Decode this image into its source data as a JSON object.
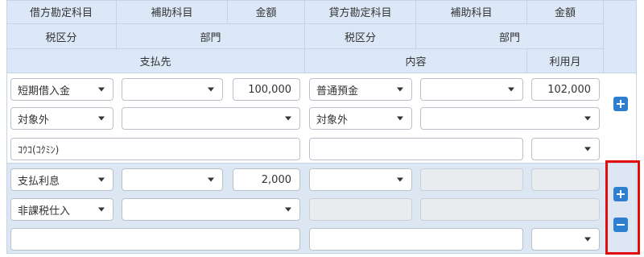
{
  "headers": {
    "row1": [
      "借方勘定科目",
      "補助科目",
      "金額",
      "貸方勘定科目",
      "補助科目",
      "金額"
    ],
    "row2": [
      "税区分",
      "部門",
      "税区分",
      "部門"
    ],
    "row3": [
      "支払先",
      "内容",
      "利用月"
    ]
  },
  "entries": [
    {
      "debit_account": "短期借入金",
      "debit_sub": "",
      "debit_amount": "100,000",
      "credit_account": "普通預金",
      "credit_sub": "",
      "credit_amount": "102,000",
      "debit_tax": "対象外",
      "debit_dept": "",
      "credit_tax": "対象外",
      "credit_dept": "",
      "payee": "ｺｳｺ(ｺｸﾐﾝ)",
      "content": "",
      "month": ""
    },
    {
      "debit_account": "支払利息",
      "debit_sub": "",
      "debit_amount": "2,000",
      "credit_account": "",
      "credit_sub": "",
      "credit_amount": "",
      "debit_tax": "非課税仕入",
      "debit_dept": "",
      "credit_tax": "",
      "credit_dept": "",
      "payee": "",
      "content": "",
      "month": ""
    }
  ],
  "icons": {
    "add": "plus-icon",
    "remove": "minus-icon"
  },
  "colors": {
    "header_bg": "#dce8f7",
    "row_alt_bg": "#dde7f4",
    "button": "#2f7fd0",
    "highlight": "#e10b0b"
  }
}
